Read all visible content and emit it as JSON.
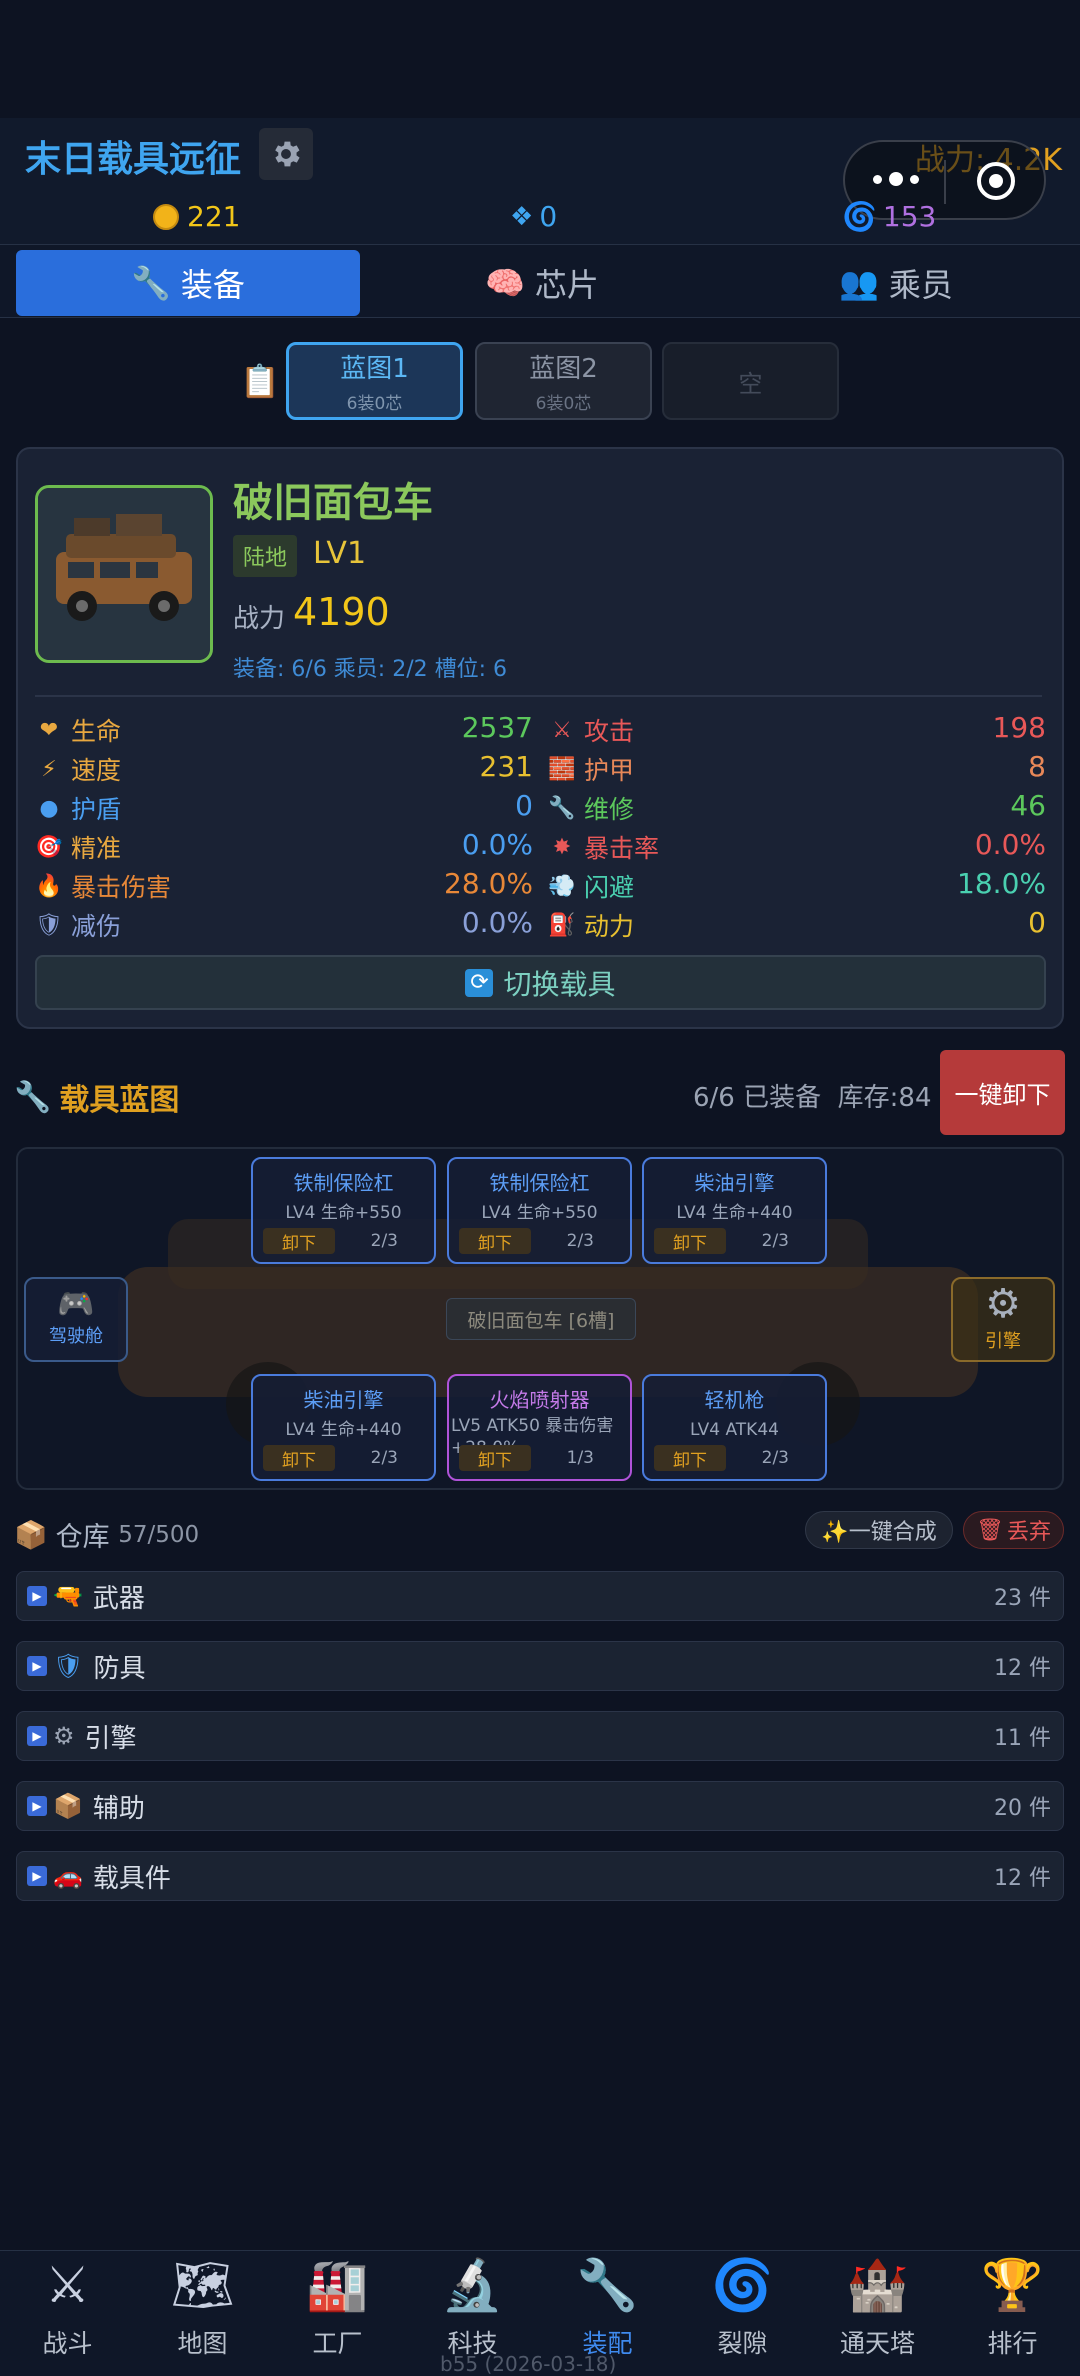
{
  "header": {
    "title": "末日载具远征",
    "power": "战力: 4.2K",
    "coins": "221",
    "diamonds": "0",
    "vortex": "153"
  },
  "tabs": [
    {
      "label": "装备"
    },
    {
      "label": "芯片"
    },
    {
      "label": "乘员"
    }
  ],
  "blueprints": [
    {
      "name": "蓝图1",
      "sub": "6装0芯"
    },
    {
      "name": "蓝图2",
      "sub": "6装0芯"
    },
    {
      "name": "空"
    }
  ],
  "vehicle": {
    "name": "破旧面包车",
    "terrain": "陆地",
    "level": "LV1",
    "power_label": "战力",
    "power": "4190",
    "meta": "装备: 6/6  乘员: 2/2  槽位: 6",
    "switch_label": "切换载具"
  },
  "stats": [
    {
      "label": "生命",
      "value": "2537",
      "icon": "heart-icon",
      "label_color": "#e8a840",
      "value_color": "#5cc85c"
    },
    {
      "label": "攻击",
      "value": "198",
      "icon": "swords-icon",
      "label_color": "#e85858",
      "value_color": "#e85858"
    },
    {
      "label": "速度",
      "value": "231",
      "icon": "lightning-icon",
      "label_color": "#e8a840",
      "value_color": "#e8c030"
    },
    {
      "label": "护甲",
      "value": "8",
      "icon": "armor-icon",
      "label_color": "#e88858",
      "value_color": "#e88858"
    },
    {
      "label": "护盾",
      "value": "0",
      "icon": "shield-dot-icon",
      "label_color": "#4a9ef0",
      "value_color": "#4a9ef0"
    },
    {
      "label": "维修",
      "value": "46",
      "icon": "wrench-icon",
      "label_color": "#5cc85c",
      "value_color": "#5cc85c"
    },
    {
      "label": "精准",
      "value": "0.0%",
      "icon": "target-icon",
      "label_color": "#e8a840",
      "value_color": "#4a9ef0"
    },
    {
      "label": "暴击率",
      "value": "0.0%",
      "icon": "burst-icon",
      "label_color": "#e85858",
      "value_color": "#e85858"
    },
    {
      "label": "暴击伤害",
      "value": "28.0%",
      "icon": "fire-icon",
      "label_color": "#e88838",
      "value_color": "#e88838"
    },
    {
      "label": "闪避",
      "value": "18.0%",
      "icon": "dash-icon",
      "label_color": "#4ad0b0",
      "value_color": "#4ad0b0"
    },
    {
      "label": "减伤",
      "value": "0.0%",
      "icon": "shield-icon",
      "label_color": "#8aa0d8",
      "value_color": "#8aa0d8"
    },
    {
      "label": "动力",
      "value": "0",
      "icon": "fuel-icon",
      "label_color": "#e8c030",
      "value_color": "#e8c030"
    }
  ],
  "blueprint_section": {
    "title": "载具蓝图",
    "status": "6/6 已装备",
    "stock": "库存:84",
    "unload_all": "一键卸下",
    "center_label": "破旧面包车 [6槽]",
    "cockpit": "驾驶舱",
    "engine": "引擎"
  },
  "slots": [
    {
      "name": "铁制保险杠",
      "desc": "LV4 生命+550",
      "btn": "卸下",
      "count": "2/3",
      "purple": false
    },
    {
      "name": "铁制保险杠",
      "desc": "LV4 生命+550",
      "btn": "卸下",
      "count": "2/3",
      "purple": false
    },
    {
      "name": "柴油引擎",
      "desc": "LV4 生命+440",
      "btn": "卸下",
      "count": "2/3",
      "purple": false
    },
    {
      "name": "柴油引擎",
      "desc": "LV4 生命+440",
      "btn": "卸下",
      "count": "2/3",
      "purple": false
    },
    {
      "name": "火焰喷射器",
      "desc": "LV5 ATK50 暴击伤害+28.0%",
      "btn": "卸下",
      "count": "1/3",
      "purple": true
    },
    {
      "name": "轻机枪",
      "desc": "LV4 ATK44",
      "btn": "卸下",
      "count": "2/3",
      "purple": false
    }
  ],
  "warehouse": {
    "title": "仓库",
    "count": "57/500",
    "merge": "✨一键合成",
    "discard": "丢弃"
  },
  "categories": [
    {
      "name": "武器",
      "count": "23 件",
      "icon": "gun-icon",
      "glyph": "🔫"
    },
    {
      "name": "防具",
      "count": "12 件",
      "icon": "shield-icon",
      "glyph": "🛡"
    },
    {
      "name": "引擎",
      "count": "11 件",
      "icon": "gear-icon",
      "glyph": "⚙"
    },
    {
      "name": "辅助",
      "count": "20 件",
      "icon": "box-icon",
      "glyph": "📦"
    },
    {
      "name": "载具件",
      "count": "12 件",
      "icon": "car-icon",
      "glyph": "🚗"
    }
  ],
  "nav": [
    {
      "label": "战斗",
      "icon": "swords-icon",
      "glyph": "⚔",
      "active": false
    },
    {
      "label": "地图",
      "icon": "map-icon",
      "glyph": "🗺",
      "active": false
    },
    {
      "label": "工厂",
      "icon": "factory-icon",
      "glyph": "🏭",
      "active": false
    },
    {
      "label": "科技",
      "icon": "microscope-icon",
      "glyph": "🔬",
      "active": false
    },
    {
      "label": "装配",
      "icon": "wrench-icon",
      "glyph": "🔧",
      "active": true
    },
    {
      "label": "裂隙",
      "icon": "vortex-icon",
      "glyph": "🌀",
      "active": false
    },
    {
      "label": "通天塔",
      "icon": "castle-icon",
      "glyph": "🏰",
      "active": false
    },
    {
      "label": "排行",
      "icon": "trophy-icon",
      "glyph": "🏆",
      "active": false
    }
  ],
  "version": "b55 (2026-03-18)"
}
